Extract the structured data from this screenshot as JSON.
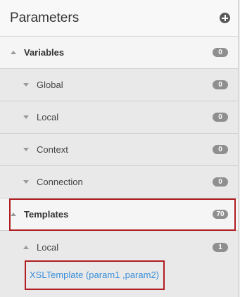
{
  "header": {
    "title": "Parameters",
    "add_icon": "plus-circle-icon"
  },
  "variables": {
    "label": "Variables",
    "count": "0",
    "items": [
      {
        "label": "Global",
        "count": "0"
      },
      {
        "label": "Local",
        "count": "0"
      },
      {
        "label": "Context",
        "count": "0"
      },
      {
        "label": "Connection",
        "count": "0"
      }
    ]
  },
  "templates": {
    "label": "Templates",
    "count": "70",
    "local": {
      "label": "Local",
      "count": "1"
    },
    "entry": "XSLTemplate (param1 ,param2)"
  },
  "colors": {
    "highlight": "#b01e23",
    "link": "#3b8fd9",
    "badge": "#8f8f8f"
  }
}
